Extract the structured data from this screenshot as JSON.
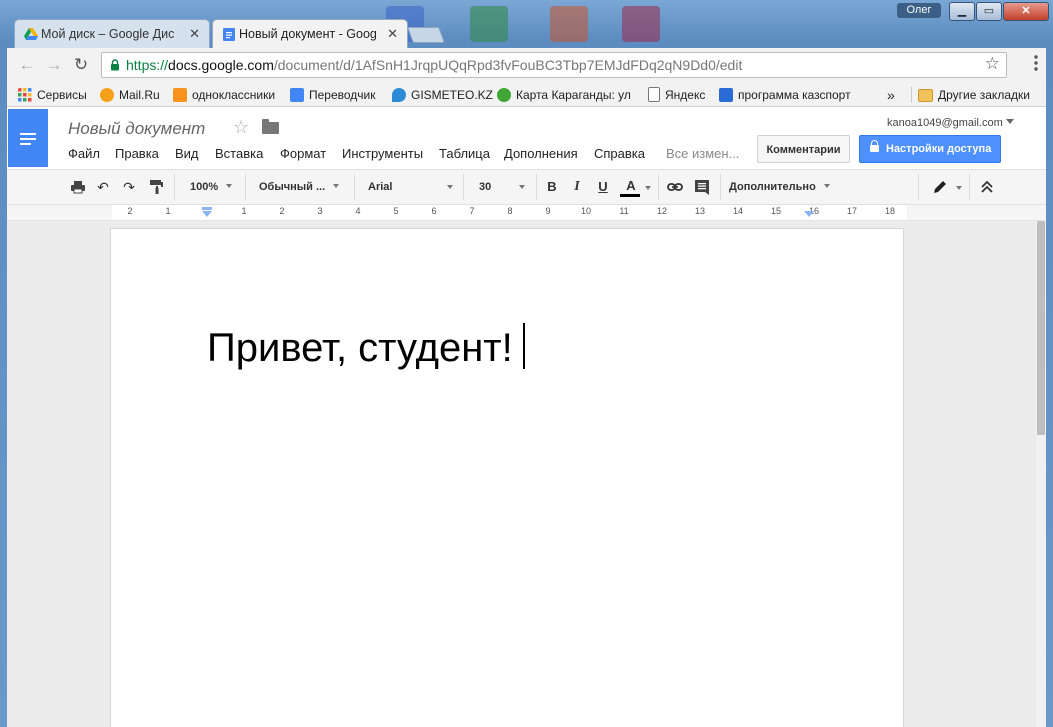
{
  "os": {
    "user_label": "Олег",
    "minimize": "▁",
    "maximize": "▭",
    "close": "✕"
  },
  "browser": {
    "tabs": [
      {
        "label": "Мой диск – Google Дис",
        "icon": "drive-icon",
        "close": "✕",
        "active": false
      },
      {
        "label": "Новый документ - Goog",
        "icon": "docs-icon",
        "close": "✕",
        "active": true
      }
    ],
    "url": {
      "scheme": "https://",
      "host": "docs.google.com",
      "path": "/document/d/1AfSnH1JrqpUQqRpd3fvFouBC3Tbp7EMJdFDq2qN9Dd0/edit"
    },
    "back": "←",
    "forward": "→",
    "reload": "↻",
    "star": "☆",
    "bookmarks": [
      {
        "label": "Сервисы",
        "icon": "apps-icon",
        "color": "#e8453c"
      },
      {
        "label": "Mail.Ru",
        "icon": "mailru-icon",
        "color": "#168de2"
      },
      {
        "label": "одноклассники",
        "icon": "ok-icon",
        "color": "#f7931e"
      },
      {
        "label": "Переводчик",
        "icon": "translate-icon",
        "color": "#4285f4"
      },
      {
        "label": "GISMETEO.KZ",
        "icon": "gismeteo-icon",
        "color": "#2b8bd6"
      },
      {
        "label": "Карта Караганды: ул",
        "icon": "2gis-icon",
        "color": "#3fa535"
      },
      {
        "label": "Яндекс",
        "icon": "page-icon",
        "color": "#ffffff"
      },
      {
        "label": "программа казспорт",
        "icon": "search-icon",
        "color": "#2b6bd6"
      }
    ],
    "bookmarks_more": "»",
    "other_bookmarks": "Другие закладки"
  },
  "docs": {
    "title": "Новый документ",
    "account": "kanoa1049@gmail.com",
    "menu": [
      "Файл",
      "Правка",
      "Вид",
      "Вставка",
      "Формат",
      "Инструменты",
      "Таблица",
      "Дополнения",
      "Справка"
    ],
    "save_status": "Все измен...",
    "comments_label": "Комментарии",
    "share_label": "Настройки доступа",
    "toolbar": {
      "zoom": "100%",
      "style": "Обычный ...",
      "font": "Arial",
      "size": "30",
      "bold": "B",
      "italic": "I",
      "underline": "U",
      "text_color": "A",
      "more": "Дополнительно"
    },
    "ruler": [
      "2",
      "1",
      "1",
      "2",
      "3",
      "4",
      "5",
      "6",
      "7",
      "8",
      "9",
      "10",
      "11",
      "12",
      "13",
      "14",
      "15",
      "16",
      "17",
      "18"
    ],
    "body_text": "Привет, студент!"
  },
  "colors": {
    "docs_blue": "#4285f4",
    "share_blue": "#4d90fe",
    "secure_green": "#0b8043"
  }
}
